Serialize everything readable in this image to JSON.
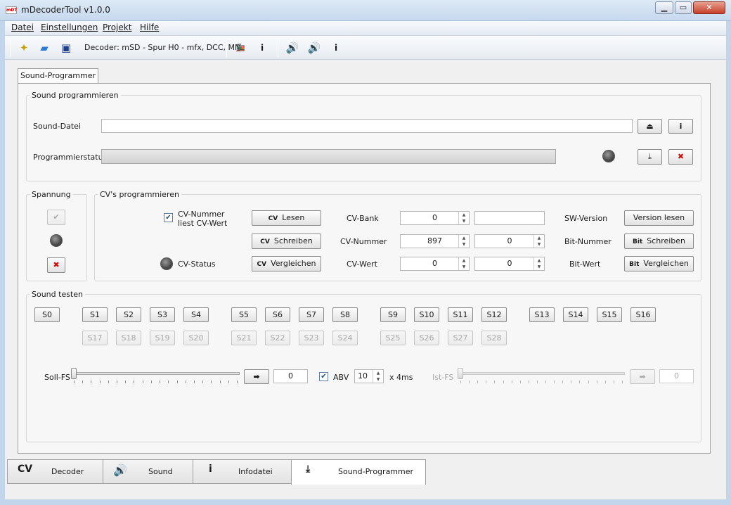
{
  "window": {
    "title": "mDecoderTool v1.0.0",
    "logo": "mDT",
    "min_icon": "minimize-icon",
    "max_icon": "maximize-icon",
    "close_icon": "close-icon"
  },
  "menu": [
    "Datei",
    "Einstellungen",
    "Projekt",
    "Hilfe"
  ],
  "toolbar": {
    "decoder_label": "Decoder: mSD - Spur H0 - mfx, DCC, MM"
  },
  "tabs_top": [
    "Sound-Programmer"
  ],
  "sound_prog": {
    "group_title": "Sound programmieren",
    "file_label": "Sound-Datei",
    "file_value": "",
    "status_label": "Programmierstatus",
    "progress_percent": 0
  },
  "spannung": {
    "title": "Spannung"
  },
  "cv": {
    "title": "CV's programmieren",
    "checkbox_label_1": "CV-Nummer",
    "checkbox_label_2": "liest CV-Wert",
    "checkbox_checked": true,
    "status_label": "CV-Status",
    "btn_lesen": "Lesen",
    "btn_schreiben": "Schreiben",
    "btn_vergleichen": "Vergleichen",
    "cv_tag": "CV",
    "bit_tag": "Bit",
    "bank_label": "CV-Bank",
    "nummer_label": "CV-Nummer",
    "wert_label": "CV-Wert",
    "bank_value": "0",
    "nummer_value": "897",
    "wert_value": "0",
    "bit_nummer_value": "0",
    "bit_wert_value": "0",
    "sw_label": "SW-Version",
    "bitnr_label": "Bit-Nummer",
    "bitwert_label": "Bit-Wert",
    "btn_version": "Version lesen",
    "btn_bit_schreiben": "Schreiben",
    "btn_bit_vergleichen": "Vergleichen"
  },
  "sound_test": {
    "title": "Sound testen",
    "row1": [
      "S0",
      "S1",
      "S2",
      "S3",
      "S4",
      "S5",
      "S6",
      "S7",
      "S8",
      "S9",
      "S10",
      "S11",
      "S12",
      "S13",
      "S14",
      "S15",
      "S16"
    ],
    "row2": [
      "S17",
      "S18",
      "S19",
      "S20",
      "S21",
      "S22",
      "S23",
      "S24",
      "S25",
      "S26",
      "S27",
      "S28"
    ],
    "soll_label": "Soll-FS",
    "soll_value": "0",
    "abv_label": "ABV",
    "abv_checked": true,
    "abv_value": "10",
    "abv_unit": "x 4ms",
    "ist_label": "Ist-FS",
    "ist_value": "0"
  },
  "tabs_bottom": [
    {
      "label": "Decoder",
      "icon": "decoder-icon"
    },
    {
      "label": "Sound",
      "icon": "speaker-icon"
    },
    {
      "label": "Infodatei",
      "icon": "info-icon"
    },
    {
      "label": "Sound-Programmer",
      "icon": "download-icon"
    }
  ]
}
